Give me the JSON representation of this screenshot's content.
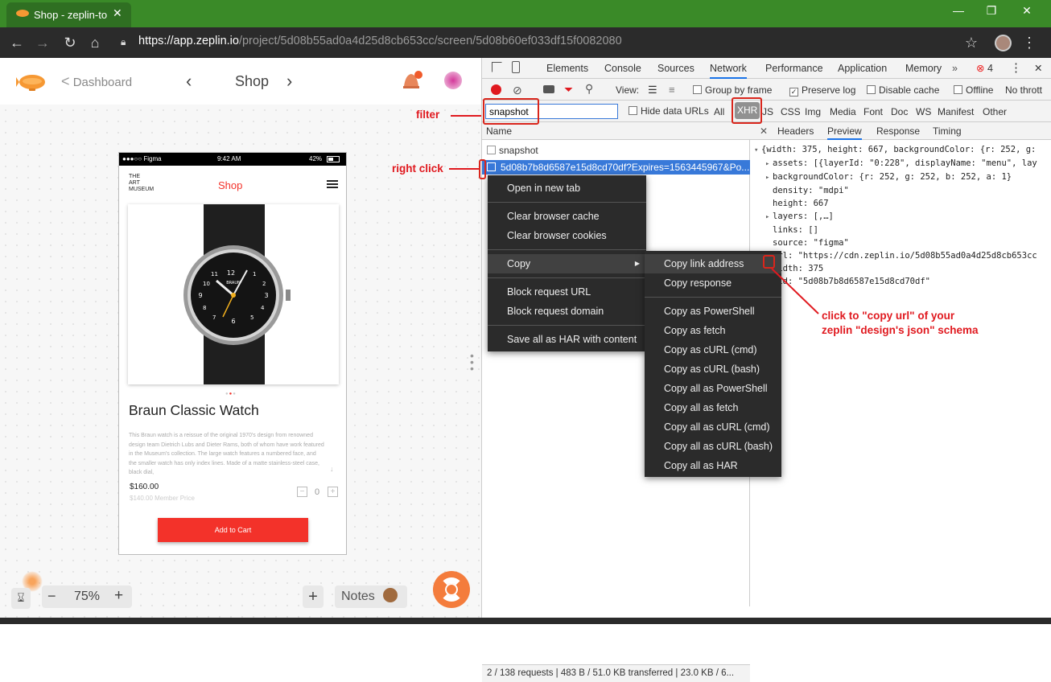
{
  "browser": {
    "tab_title": "Shop - zeplin-to",
    "url_host": "https://app.zeplin.io",
    "url_path": "/project/5d08b55ad0a4d25d8cb653cc/screen/5d08b60ef033df15f0082080"
  },
  "zeplin": {
    "back_label": "Dashboard",
    "screen_title": "Shop",
    "zoom": "75%",
    "notes_label": "Notes",
    "minus": "−",
    "plus": "+"
  },
  "phone": {
    "carrier": "●●●○○ Figma",
    "time": "9:42 AM",
    "battery": "42%",
    "logo_line1": "THE",
    "logo_line2": "ART",
    "logo_line3": "MUSEUM",
    "page_title": "Shop",
    "product_name": "Braun Classic Watch",
    "description": "This Braun watch is a reissue of the original 1970's design from renowned design team Dietrich Lubs and Dieter Rams, both of whom have work featured in the Museum's collection. The large watch features a numbered face, and the smaller watch has only index lines. Made of a matte stainless-steel case, black dial,",
    "price": "$160.00",
    "member_price": "$140.00 Member Price",
    "qty": "0",
    "add_to_cart": "Add to Cart",
    "watch_brand": "BRAUN"
  },
  "devtools": {
    "tabs": [
      "Elements",
      "Console",
      "Sources",
      "Network",
      "Performance",
      "Application",
      "Memory"
    ],
    "active_tab": "Network",
    "error_count": "4",
    "toolbar": {
      "view_label": "View:",
      "group_by_frame": "Group by frame",
      "preserve_log": "Preserve log",
      "disable_cache": "Disable cache",
      "offline": "Offline",
      "no_throttling": "No thrott"
    },
    "filter_value": "snapshot",
    "hide_data_urls": "Hide data URLs",
    "type_filters": [
      "All",
      "XHR",
      "JS",
      "CSS",
      "Img",
      "Media",
      "Font",
      "Doc",
      "WS",
      "Manifest",
      "Other"
    ],
    "active_filter": "XHR",
    "column_name": "Name",
    "requests": [
      "snapshot",
      "5d08b7b8d6587e15d8cd70df?Expires=1563445967&Po..."
    ],
    "detail_tabs": [
      "Headers",
      "Preview",
      "Response",
      "Timing"
    ],
    "active_detail_tab": "Preview",
    "status": "2 / 138 requests  |  483 B / 51.0 KB transferred  |  23.0 KB / 6...",
    "preview_lines": [
      {
        "t": "{width: 375, height: 667, backgroundColor: {r: 252, g:",
        "arrow": "▾"
      },
      {
        "t": "assets: [{layerId: \"0:228\", displayName: \"menu\", lay",
        "arrow": "▸"
      },
      {
        "t": "backgroundColor: {r: 252, g: 252, b: 252, a: 1}",
        "arrow": "▸"
      },
      {
        "t": "density: \"mdpi\"",
        "arrow": ""
      },
      {
        "t": "height: 667",
        "arrow": ""
      },
      {
        "t": "layers: [,…]",
        "arrow": "▸"
      },
      {
        "t": "links: []",
        "arrow": ""
      },
      {
        "t": "source: \"figma\"",
        "arrow": ""
      },
      {
        "t": "url: \"https://cdn.zeplin.io/5d08b55ad0a4d25d8cb653cc",
        "arrow": ""
      },
      {
        "t": "width: 375",
        "arrow": ""
      },
      {
        "t": "_id: \"5d08b7b8d6587e15d8cd70df\"",
        "arrow": ""
      }
    ]
  },
  "context_menu": {
    "items": [
      "Open in new tab",
      "Clear browser cache",
      "Clear browser cookies",
      "Copy",
      "Block request URL",
      "Block request domain",
      "Save all as HAR with content"
    ]
  },
  "copy_submenu": {
    "items": [
      "Copy link address",
      "Copy response",
      "Copy as PowerShell",
      "Copy as fetch",
      "Copy as cURL (cmd)",
      "Copy as cURL (bash)",
      "Copy all as PowerShell",
      "Copy all as fetch",
      "Copy all as cURL (cmd)",
      "Copy all as cURL (bash)",
      "Copy all as HAR"
    ]
  },
  "annotations": {
    "filter": "filter",
    "right_click": "right click",
    "copy_url_line1": "click to \"copy url\" of your",
    "copy_url_line2": "zeplin \"design's json\" schema"
  },
  "colors": {
    "accent_red": "#e0191f",
    "selected_row": "#3879d9",
    "cart_button": "#f3322a"
  }
}
